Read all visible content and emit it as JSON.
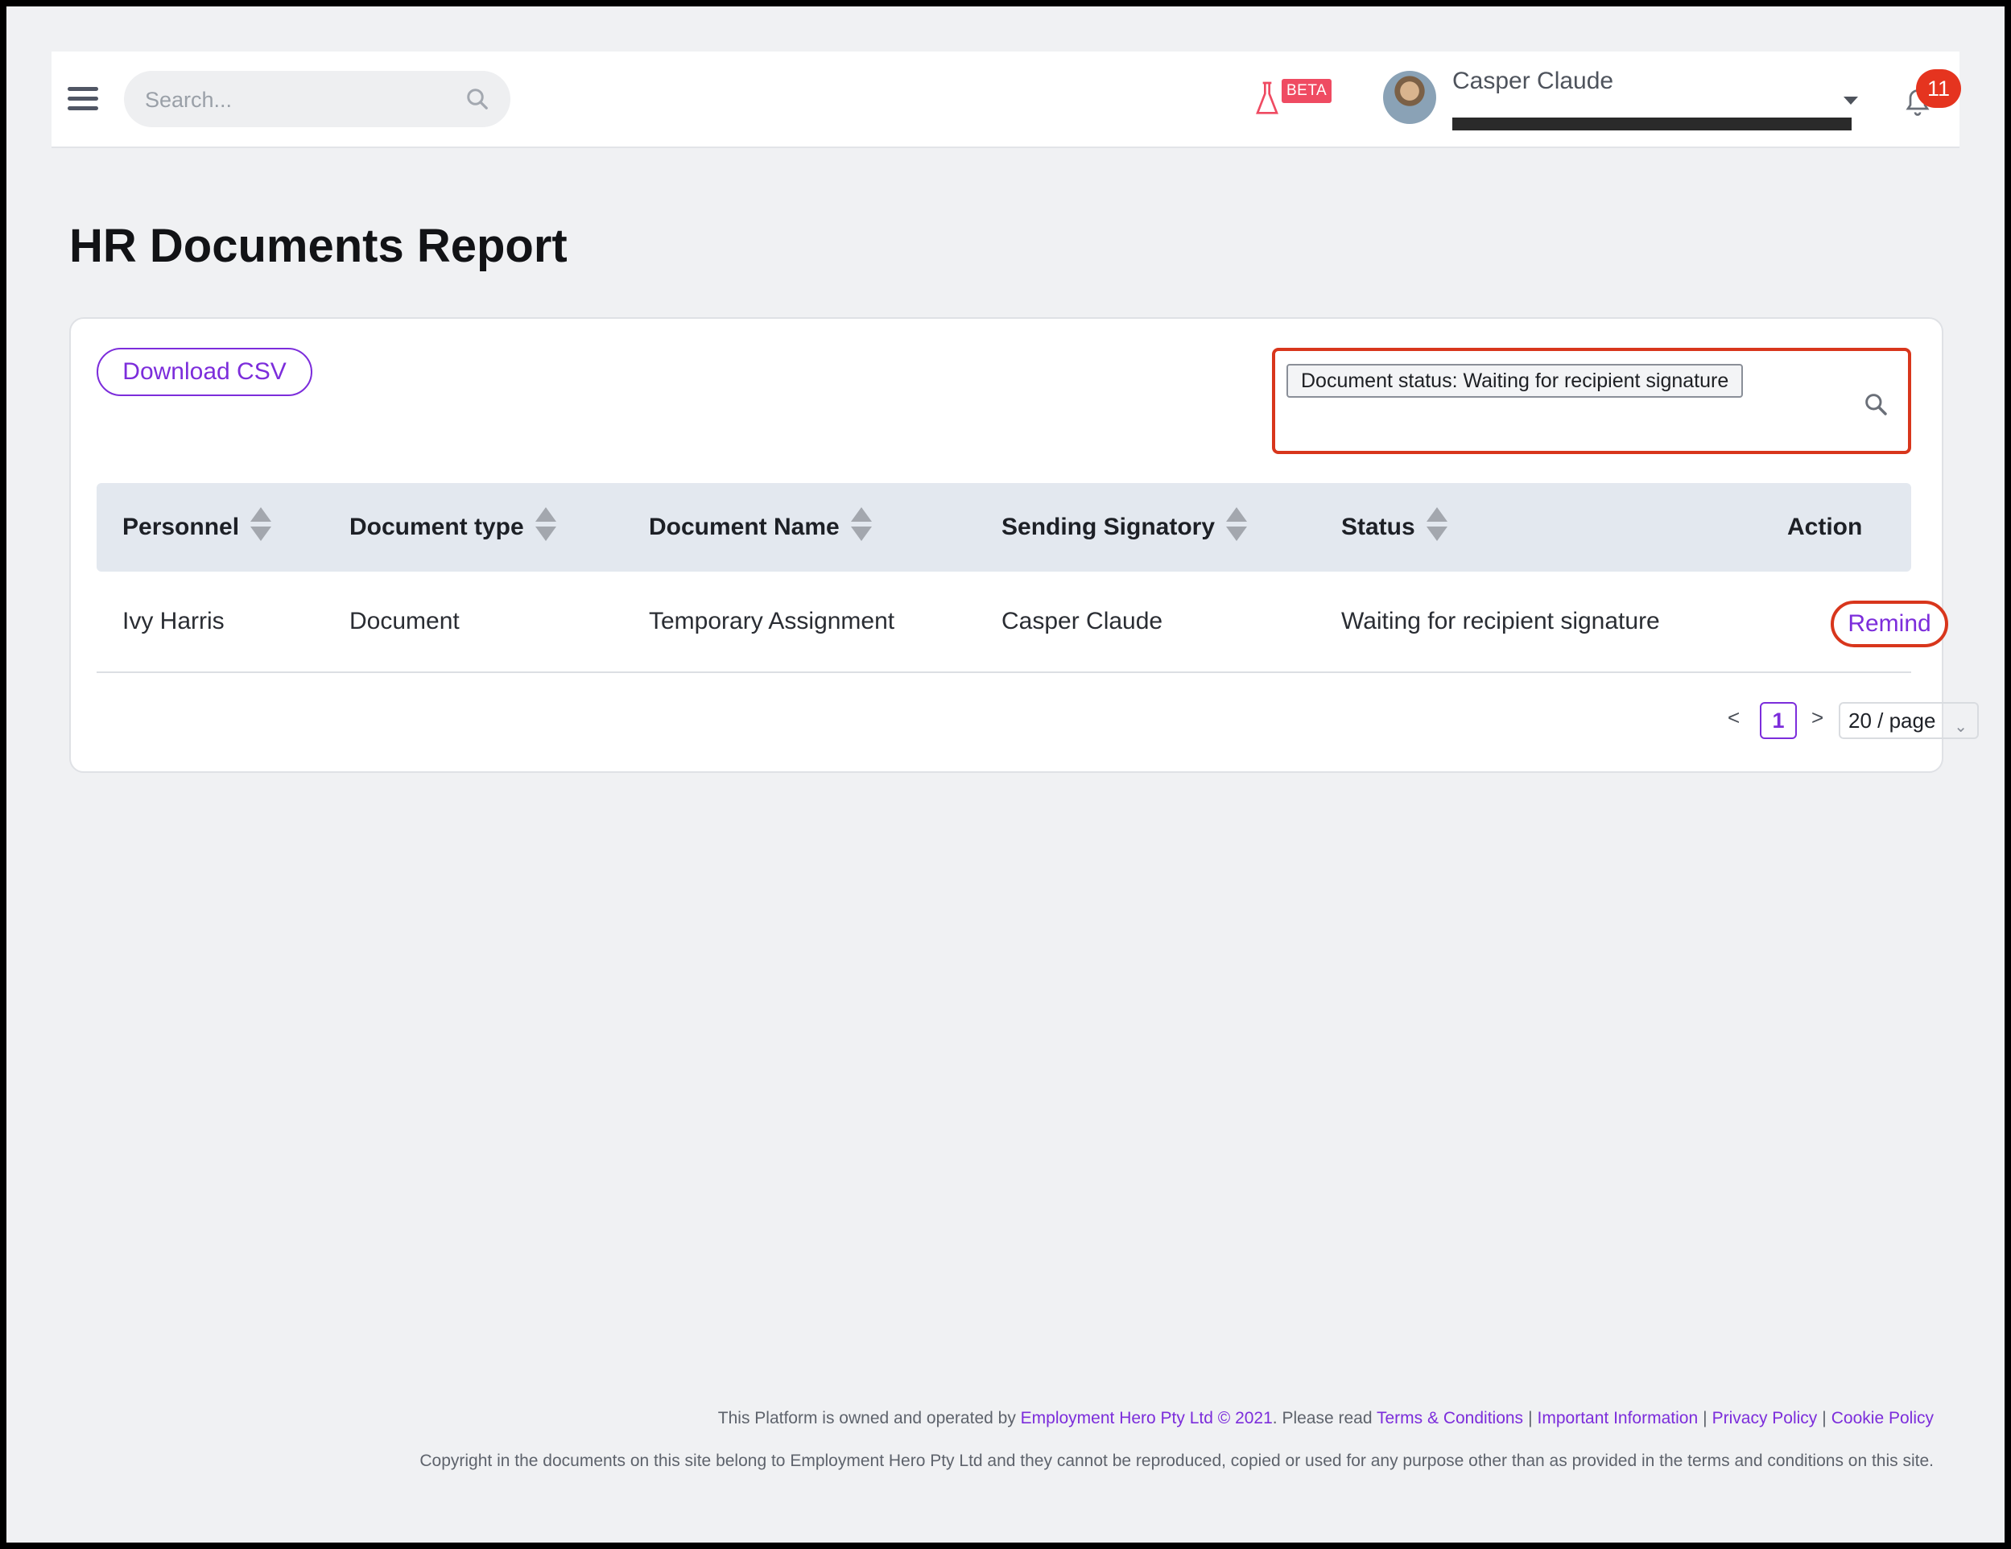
{
  "header": {
    "search_placeholder": "Search...",
    "beta_label": "BETA",
    "user_name": "Casper Claude",
    "notification_count": "11"
  },
  "page": {
    "title": "HR Documents Report"
  },
  "toolbar": {
    "download_csv_label": "Download CSV",
    "filter_chip": "Document status: Waiting for recipient signature"
  },
  "table": {
    "columns": [
      "Personnel",
      "Document type",
      "Document Name",
      "Sending Signatory",
      "Status",
      "Action"
    ],
    "rows": [
      {
        "personnel": "Ivy Harris",
        "document_type": "Document",
        "document_name": "Temporary Assignment",
        "sending_signatory": "Casper Claude",
        "status": "Waiting for recipient signature",
        "action": "Remind"
      }
    ]
  },
  "pagination": {
    "prev": "<",
    "current_page": "1",
    "next": ">",
    "page_size": "20 / page"
  },
  "footer": {
    "line1_prefix": "This Platform is owned and operated by ",
    "company_link": "Employment Hero Pty Ltd © 2021",
    "line1_mid": ". Please read ",
    "links": [
      "Terms & Conditions",
      "Important Information",
      "Privacy Policy",
      "Cookie Policy"
    ],
    "line2": "Copyright in the documents on this site belong to Employment Hero Pty Ltd and they cannot be reproduced, copied or used for any purpose other than as provided in the terms and conditions on this site."
  },
  "colors": {
    "accent": "#7c2ddb",
    "highlight_border": "#d8361c",
    "badge": "#e5341f",
    "beta": "#ef4b62"
  }
}
